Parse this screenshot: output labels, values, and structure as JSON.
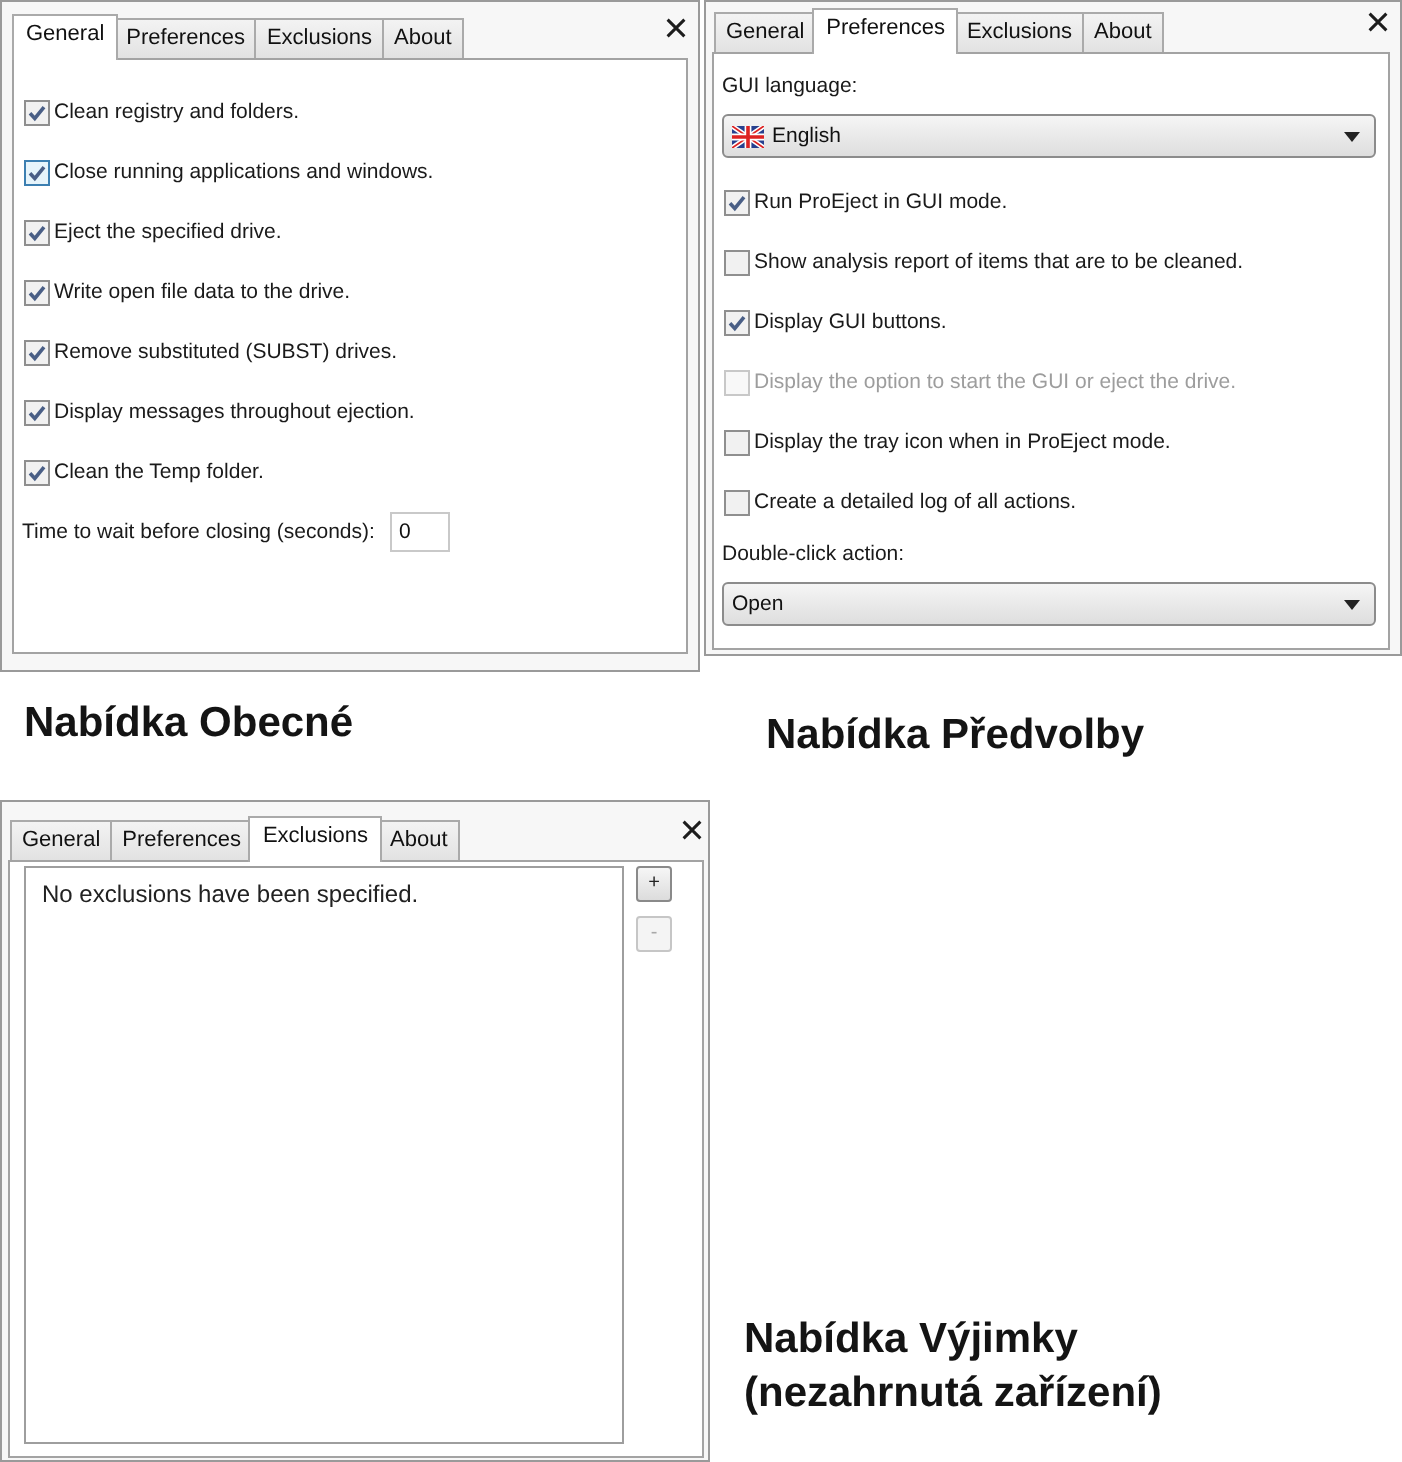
{
  "panels": [
    {
      "kind": "general",
      "tabs": [
        {
          "label": "General",
          "selected": true
        },
        {
          "label": "Preferences",
          "selected": false
        },
        {
          "label": "Exclusions",
          "selected": false
        },
        {
          "label": "About",
          "selected": false
        }
      ],
      "options": [
        {
          "label": "Clean registry and folders.",
          "checked": true,
          "highlighted": false
        },
        {
          "label": "Close running applications and windows.",
          "checked": true,
          "highlighted": true
        },
        {
          "label": "Eject the specified drive.",
          "checked": true,
          "highlighted": false
        },
        {
          "label": "Write open file data to the drive.",
          "checked": true,
          "highlighted": false
        },
        {
          "label": "Remove substituted (SUBST) drives.",
          "checked": true,
          "highlighted": false
        },
        {
          "label": "Display messages throughout ejection.",
          "checked": true,
          "highlighted": false
        },
        {
          "label": "Clean the Temp folder.",
          "checked": true,
          "highlighted": false
        }
      ],
      "wait_field": {
        "label": "Time to wait before closing (seconds):",
        "value": "0"
      },
      "caption": "Nabídka Obecné"
    },
    {
      "kind": "preferences",
      "tabs": [
        {
          "label": "General",
          "selected": false
        },
        {
          "label": "Preferences",
          "selected": true
        },
        {
          "label": "Exclusions",
          "selected": false
        },
        {
          "label": "About",
          "selected": false
        }
      ],
      "language": {
        "label": "GUI language:",
        "value": "English"
      },
      "options": [
        {
          "label": "Run ProEject in GUI mode.",
          "checked": true,
          "disabled": false
        },
        {
          "label": "Show analysis report of items that are to be cleaned.",
          "checked": false,
          "disabled": false
        },
        {
          "label": "Display GUI buttons.",
          "checked": true,
          "disabled": false
        },
        {
          "label": "Display the option to start the GUI or eject the drive.",
          "checked": false,
          "disabled": true
        },
        {
          "label": "Display the tray icon when in ProEject mode.",
          "checked": false,
          "disabled": false
        },
        {
          "label": "Create a detailed log of all actions.",
          "checked": false,
          "disabled": false
        }
      ],
      "double_click": {
        "label": "Double-click action:",
        "value": "Open"
      },
      "caption": "Nabídka Předvolby"
    },
    {
      "kind": "exclusions",
      "tabs": [
        {
          "label": "General",
          "selected": false
        },
        {
          "label": "Preferences",
          "selected": false
        },
        {
          "label": "Exclusions",
          "selected": true
        },
        {
          "label": "About",
          "selected": false
        }
      ],
      "list": {
        "message": "No exclusions have been specified."
      },
      "buttons": [
        {
          "label": "+",
          "disabled": false
        },
        {
          "label": "-",
          "disabled": true
        }
      ],
      "caption": "Nabídka Výjimky (nezahrnutá zařízení)"
    }
  ]
}
